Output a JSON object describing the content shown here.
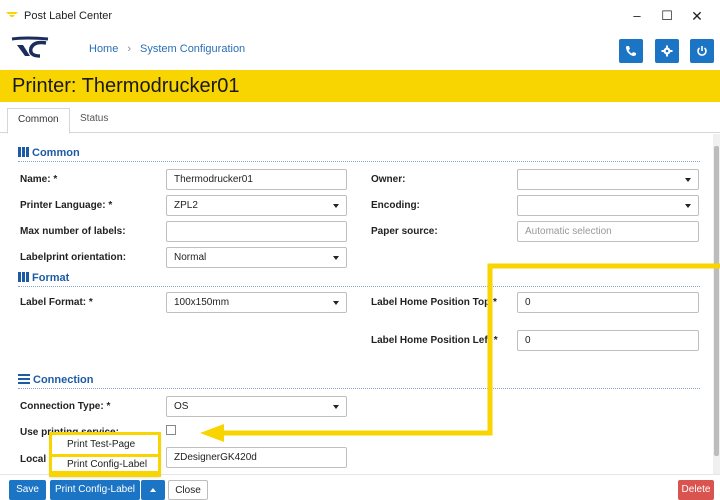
{
  "window": {
    "title": "Post Label Center",
    "minimize": "–",
    "maximize": "☐",
    "close": "✕"
  },
  "breadcrumb": {
    "home": "Home",
    "separator": "›",
    "current": "System Configuration"
  },
  "header_buttons": [
    "phone-icon",
    "gear-icon",
    "power-icon"
  ],
  "page_title": "Printer: Thermodrucker01",
  "tabs": [
    {
      "label": "Common",
      "active": true
    },
    {
      "label": "Status",
      "active": false
    }
  ],
  "sections": {
    "common": "Common",
    "format": "Format",
    "connection": "Connection"
  },
  "form": {
    "name": {
      "label": "Name: *",
      "value": "Thermodrucker01"
    },
    "owner": {
      "label": "Owner:",
      "value": ""
    },
    "printer_language": {
      "label": "Printer Language: *",
      "value": "ZPL2"
    },
    "encoding": {
      "label": "Encoding:",
      "value": ""
    },
    "max_labels": {
      "label": "Max number of labels:",
      "value": ""
    },
    "paper_source": {
      "label": "Paper source:",
      "placeholder": "Automatic selection"
    },
    "orientation": {
      "label": "Labelprint orientation:",
      "value": "Normal"
    },
    "label_format": {
      "label": "Label Format: *",
      "value": "100x150mm"
    },
    "home_top": {
      "label": "Label Home Position Top *",
      "value": "0"
    },
    "home_left": {
      "label": "Label Home Position Left *",
      "value": "0"
    },
    "connection_type": {
      "label": "Connection Type: *",
      "value": "OS"
    },
    "use_printing_service": {
      "label": "Use printing service:",
      "checked": false
    },
    "local_printer": {
      "label": "Local",
      "value": "ZDesignerGK420d"
    }
  },
  "footer": {
    "save": "Save",
    "print_config": "Print Config-Label",
    "close": "Close",
    "delete": "Delete"
  },
  "dropup_menu": {
    "items": [
      "Print Test-Page",
      "Print Config-Label"
    ],
    "highlighted": "Print Config-Label"
  },
  "colors": {
    "brand_yellow": "#f8d401",
    "primary_blue": "#1b74c4",
    "section_blue": "#1e5ba6",
    "danger_red": "#d9534f"
  }
}
